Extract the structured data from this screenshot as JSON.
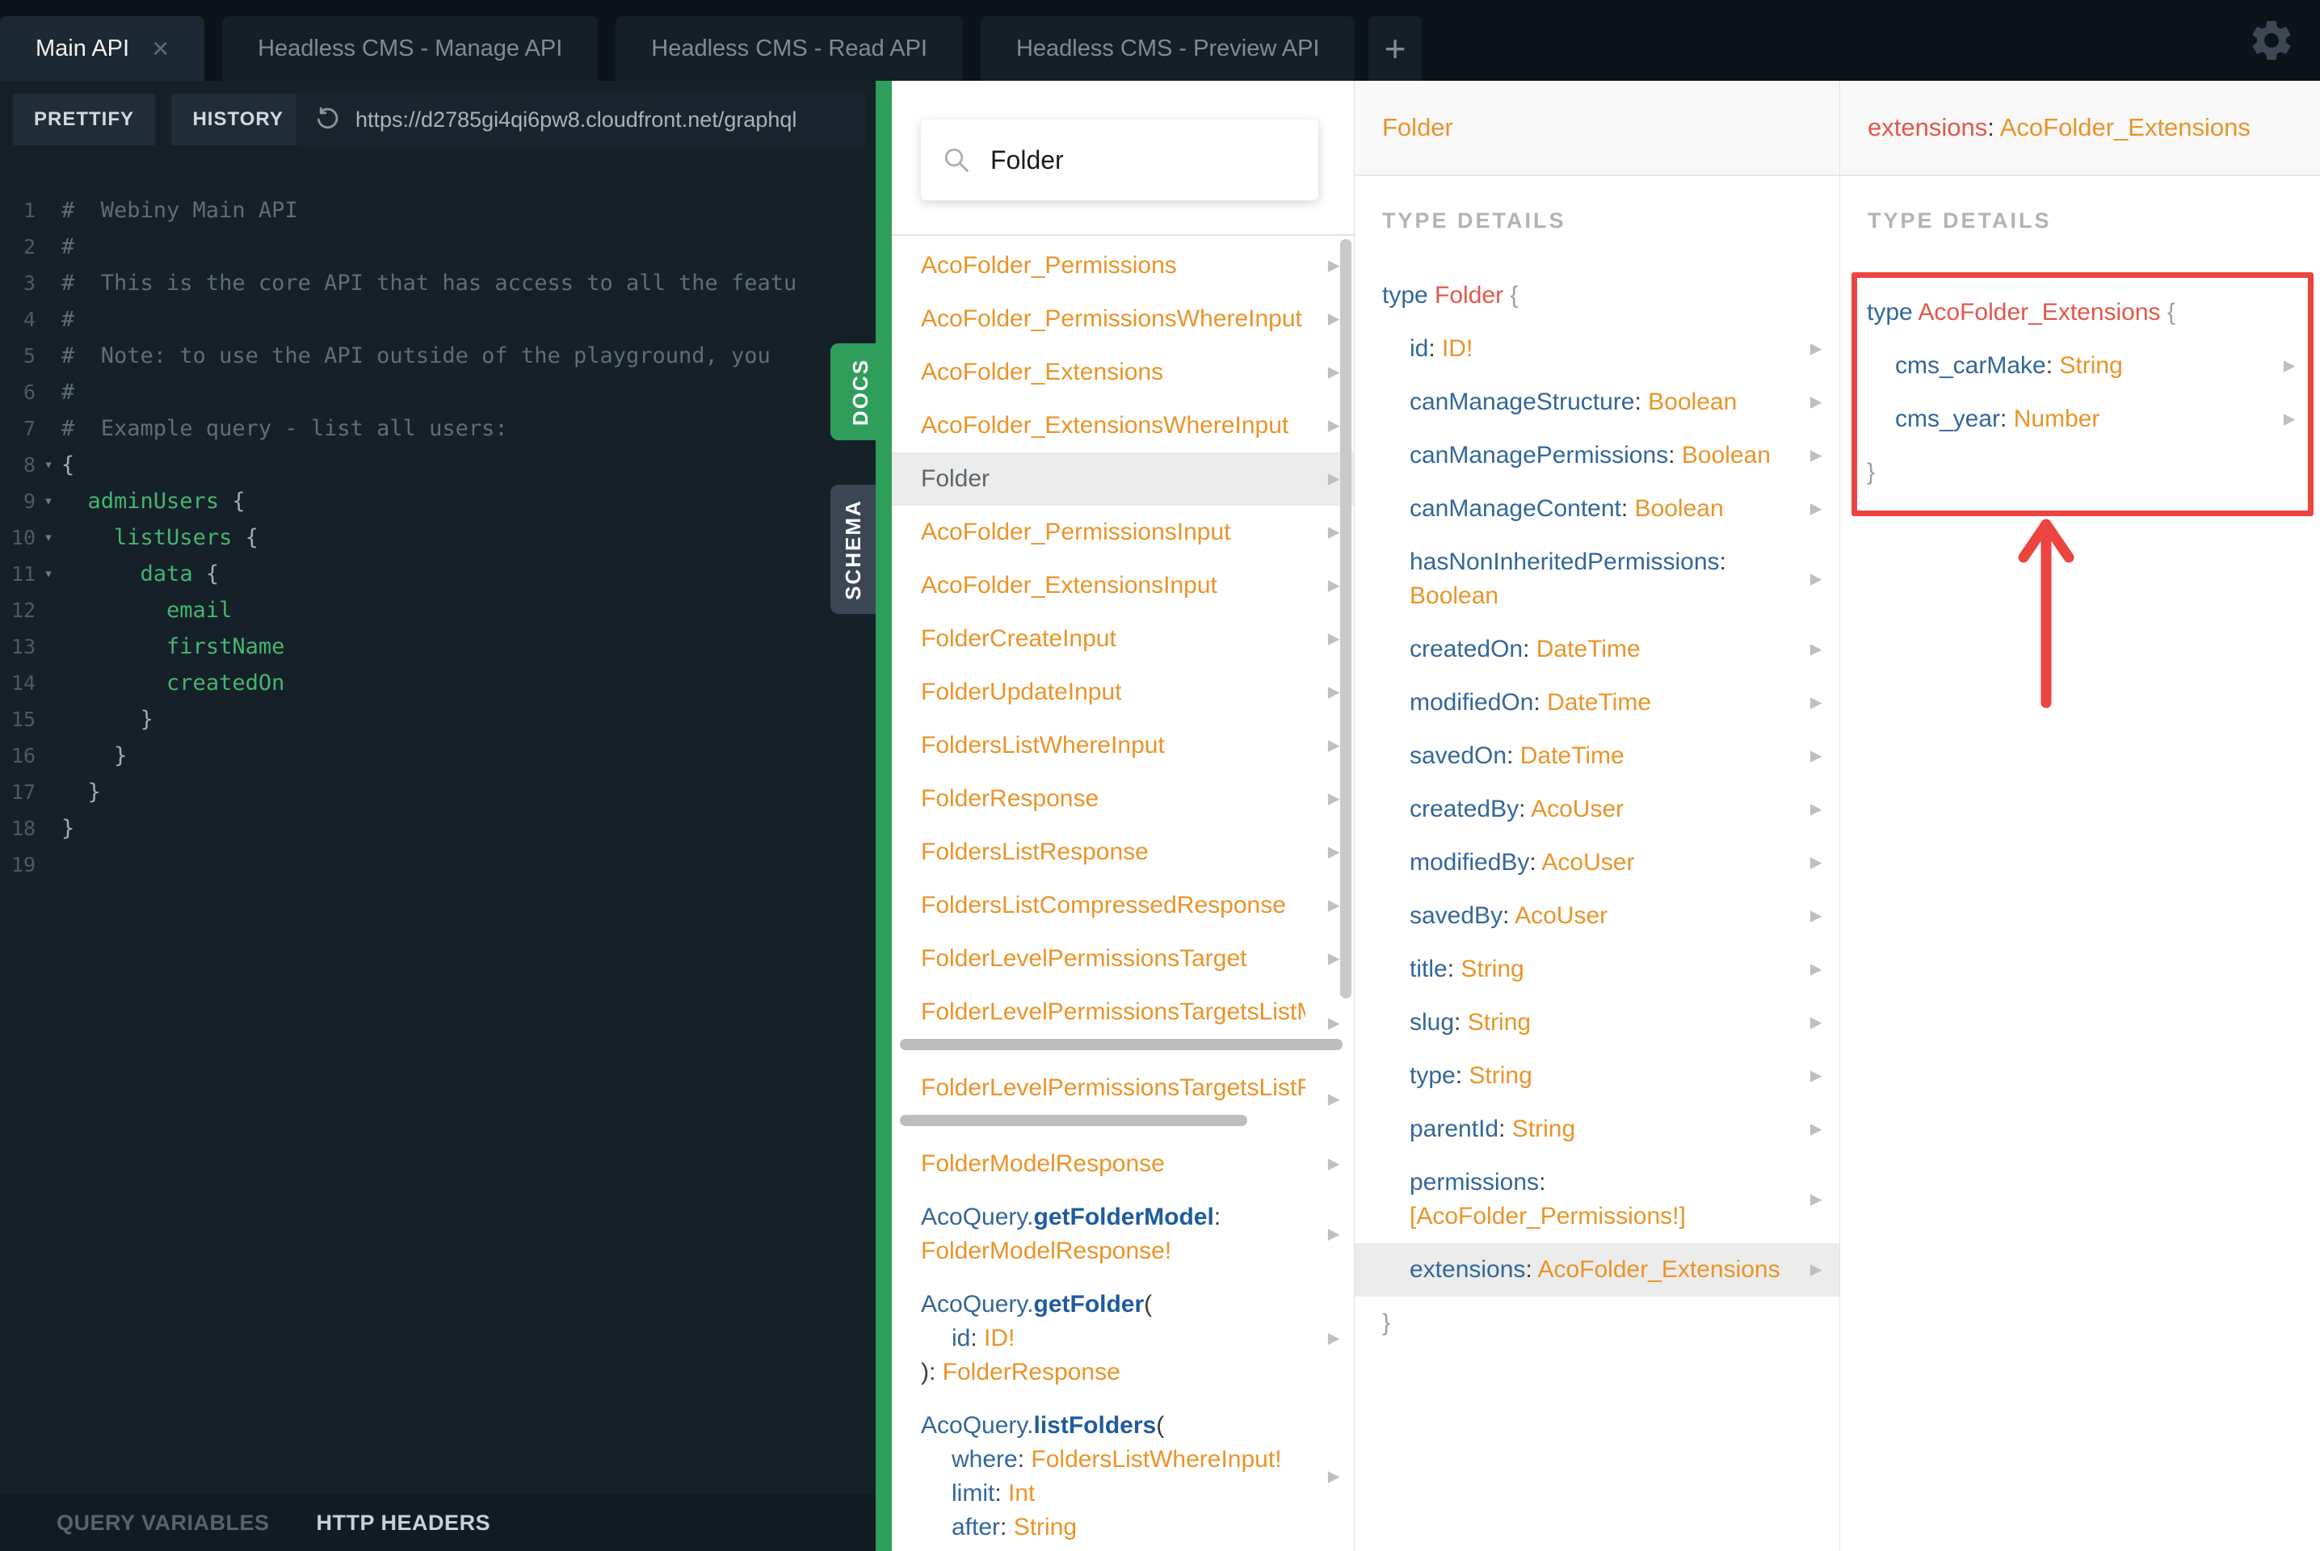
{
  "window": {
    "tabs": [
      {
        "label": "Main API",
        "active": true,
        "closable": true
      },
      {
        "label": "Headless CMS - Manage API",
        "active": false,
        "closable": false
      },
      {
        "label": "Headless CMS - Read API",
        "active": false,
        "closable": false
      },
      {
        "label": "Headless CMS - Preview API",
        "active": false,
        "closable": false
      }
    ],
    "new_tab_label": "+"
  },
  "toolbar": {
    "prettify": "PRETTIFY",
    "history": "HISTORY",
    "url": "https://d2785gi4qi6pw8.cloudfront.net/graphql"
  },
  "editor": {
    "lines": [
      {
        "n": "1",
        "fold": false,
        "s": [
          [
            "c",
            "#  Webiny Main API"
          ]
        ]
      },
      {
        "n": "2",
        "fold": false,
        "s": [
          [
            "c",
            "#"
          ]
        ]
      },
      {
        "n": "3",
        "fold": false,
        "s": [
          [
            "c",
            "#  This is the core API that has access to all the featu"
          ]
        ]
      },
      {
        "n": "4",
        "fold": false,
        "s": [
          [
            "c",
            "#"
          ]
        ]
      },
      {
        "n": "5",
        "fold": false,
        "s": [
          [
            "c",
            "#  Note: to use the API outside of the playground, you"
          ]
        ]
      },
      {
        "n": "6",
        "fold": false,
        "s": [
          [
            "c",
            "#"
          ]
        ]
      },
      {
        "n": "7",
        "fold": false,
        "s": [
          [
            "c",
            "#  Example query - list all users:"
          ]
        ]
      },
      {
        "n": "8",
        "fold": true,
        "s": [
          [
            "p",
            "{"
          ]
        ]
      },
      {
        "n": "9",
        "fold": true,
        "s": [
          [
            "p",
            "  "
          ],
          [
            "g",
            "adminUsers"
          ],
          [
            "p",
            " {"
          ]
        ]
      },
      {
        "n": "10",
        "fold": true,
        "s": [
          [
            "p",
            "    "
          ],
          [
            "g",
            "listUsers"
          ],
          [
            "p",
            " {"
          ]
        ]
      },
      {
        "n": "11",
        "fold": true,
        "s": [
          [
            "p",
            "      "
          ],
          [
            "g",
            "data"
          ],
          [
            "p",
            " {"
          ]
        ]
      },
      {
        "n": "12",
        "fold": false,
        "s": [
          [
            "p",
            "        "
          ],
          [
            "g",
            "email"
          ]
        ]
      },
      {
        "n": "13",
        "fold": false,
        "s": [
          [
            "p",
            "        "
          ],
          [
            "g",
            "firstName"
          ]
        ]
      },
      {
        "n": "14",
        "fold": false,
        "s": [
          [
            "p",
            "        "
          ],
          [
            "g",
            "createdOn"
          ]
        ]
      },
      {
        "n": "15",
        "fold": false,
        "s": [
          [
            "p",
            "      }"
          ]
        ]
      },
      {
        "n": "16",
        "fold": false,
        "s": [
          [
            "p",
            "    }"
          ]
        ]
      },
      {
        "n": "17",
        "fold": false,
        "s": [
          [
            "p",
            "  }"
          ]
        ]
      },
      {
        "n": "18",
        "fold": false,
        "s": [
          [
            "p",
            "}"
          ]
        ]
      },
      {
        "n": "19",
        "fold": false,
        "s": []
      }
    ]
  },
  "side_tabs": {
    "docs": "DOCS",
    "schema": "SCHEMA"
  },
  "footer": {
    "query_variables": "QUERY VARIABLES",
    "http_headers": "HTTP HEADERS"
  },
  "docs_panel": {
    "search_value": "Folder",
    "items": [
      {
        "arrow": true,
        "lines": [
          {
            "s": [
              [
                "t",
                "AcoFolder_Permissions"
              ]
            ]
          }
        ]
      },
      {
        "arrow": true,
        "lines": [
          {
            "s": [
              [
                "t",
                "AcoFolder_PermissionsWhereInput"
              ]
            ]
          }
        ]
      },
      {
        "arrow": true,
        "lines": [
          {
            "s": [
              [
                "t",
                "AcoFolder_Extensions"
              ]
            ]
          }
        ]
      },
      {
        "arrow": true,
        "lines": [
          {
            "s": [
              [
                "t",
                "AcoFolder_ExtensionsWhereInput"
              ]
            ]
          }
        ]
      },
      {
        "arrow": true,
        "highlight": true,
        "lines": [
          {
            "s": [
              [
                "sel",
                "Folder"
              ]
            ]
          }
        ]
      },
      {
        "arrow": true,
        "lines": [
          {
            "s": [
              [
                "t",
                "AcoFolder_PermissionsInput"
              ]
            ]
          }
        ]
      },
      {
        "arrow": true,
        "lines": [
          {
            "s": [
              [
                "t",
                "AcoFolder_ExtensionsInput"
              ]
            ]
          }
        ]
      },
      {
        "arrow": true,
        "lines": [
          {
            "s": [
              [
                "t",
                "FolderCreateInput"
              ]
            ]
          }
        ]
      },
      {
        "arrow": true,
        "lines": [
          {
            "s": [
              [
                "t",
                "FolderUpdateInput"
              ]
            ]
          }
        ]
      },
      {
        "arrow": true,
        "lines": [
          {
            "s": [
              [
                "t",
                "FoldersListWhereInput"
              ]
            ]
          }
        ]
      },
      {
        "arrow": true,
        "lines": [
          {
            "s": [
              [
                "t",
                "FolderResponse"
              ]
            ]
          }
        ]
      },
      {
        "arrow": true,
        "lines": [
          {
            "s": [
              [
                "t",
                "FoldersListResponse"
              ]
            ]
          }
        ]
      },
      {
        "arrow": true,
        "lines": [
          {
            "s": [
              [
                "t",
                "FoldersListCompressedResponse"
              ]
            ]
          }
        ]
      },
      {
        "arrow": true,
        "lines": [
          {
            "s": [
              [
                "t",
                "FolderLevelPermissionsTarget"
              ]
            ]
          }
        ]
      },
      {
        "arrow": true,
        "hbar": 548,
        "lines": [
          {
            "s": [
              [
                "t",
                "FolderLevelPermissionsTargetsListMeta"
              ]
            ]
          }
        ]
      },
      {
        "arrow": true,
        "hbar": 430,
        "lines": [
          {
            "s": [
              [
                "t",
                "FolderLevelPermissionsTargetsListRespo"
              ]
            ]
          }
        ]
      },
      {
        "arrow": true,
        "lines": [
          {
            "s": [
              [
                "t",
                "FolderModelResponse"
              ]
            ]
          }
        ]
      },
      {
        "arrow": true,
        "lines": [
          {
            "s": [
              [
                "q",
                "AcoQuery."
              ],
              [
                "qb",
                "getFolderModel"
              ],
              [
                "pu",
                ":"
              ]
            ]
          },
          {
            "s": [
              [
                "t",
                "FolderModelResponse!"
              ]
            ]
          }
        ]
      },
      {
        "arrow": true,
        "lines": [
          {
            "s": [
              [
                "q",
                "AcoQuery."
              ],
              [
                "qb",
                "getFolder"
              ],
              [
                "pu",
                "("
              ]
            ]
          },
          {
            "ind": 1,
            "s": [
              [
                "q",
                "id"
              ],
              [
                "pu",
                ": "
              ],
              [
                "t",
                "ID!"
              ]
            ]
          },
          {
            "s": [
              [
                "pu",
                "): "
              ],
              [
                "t",
                "FolderResponse"
              ]
            ]
          }
        ]
      },
      {
        "arrow": true,
        "lines": [
          {
            "s": [
              [
                "q",
                "AcoQuery."
              ],
              [
                "qb",
                "listFolders"
              ],
              [
                "pu",
                "("
              ]
            ]
          },
          {
            "ind": 1,
            "s": [
              [
                "q",
                "where"
              ],
              [
                "pu",
                ": "
              ],
              [
                "t",
                "FoldersListWhereInput!"
              ]
            ]
          },
          {
            "ind": 1,
            "s": [
              [
                "q",
                "limit"
              ],
              [
                "pu",
                ": "
              ],
              [
                "t",
                "Int"
              ]
            ]
          },
          {
            "ind": 1,
            "s": [
              [
                "q",
                "after"
              ],
              [
                "pu",
                ": "
              ],
              [
                "t",
                "String"
              ]
            ]
          }
        ]
      }
    ]
  },
  "type_panel": {
    "header": "Folder",
    "section_label": "TYPE DETAILS",
    "rows": [
      {
        "s": [
          [
            "kw",
            "type "
          ],
          [
            "name",
            "Folder "
          ],
          [
            "brace",
            "{"
          ]
        ]
      },
      {
        "ind": 1,
        "arrow": true,
        "s": [
          [
            "fld",
            "id"
          ],
          [
            "pu",
            ": "
          ],
          [
            "t",
            "ID!"
          ]
        ]
      },
      {
        "ind": 1,
        "arrow": true,
        "s": [
          [
            "fld",
            "canManageStructure"
          ],
          [
            "pu",
            ": "
          ],
          [
            "t",
            "Boolean"
          ]
        ]
      },
      {
        "ind": 1,
        "arrow": true,
        "s": [
          [
            "fld",
            "canManagePermissions"
          ],
          [
            "pu",
            ": "
          ],
          [
            "t",
            "Boolean"
          ]
        ]
      },
      {
        "ind": 1,
        "arrow": true,
        "s": [
          [
            "fld",
            "canManageContent"
          ],
          [
            "pu",
            ": "
          ],
          [
            "t",
            "Boolean"
          ]
        ]
      },
      {
        "ind": 1,
        "arrow": true,
        "s": [
          [
            "fld",
            "hasNonInheritedPermissions"
          ],
          [
            "pu",
            ": "
          ],
          [
            "t",
            "Boolean"
          ]
        ]
      },
      {
        "ind": 1,
        "arrow": true,
        "s": [
          [
            "fld",
            "createdOn"
          ],
          [
            "pu",
            ": "
          ],
          [
            "t",
            "DateTime"
          ]
        ]
      },
      {
        "ind": 1,
        "arrow": true,
        "s": [
          [
            "fld",
            "modifiedOn"
          ],
          [
            "pu",
            ": "
          ],
          [
            "t",
            "DateTime"
          ]
        ]
      },
      {
        "ind": 1,
        "arrow": true,
        "s": [
          [
            "fld",
            "savedOn"
          ],
          [
            "pu",
            ": "
          ],
          [
            "t",
            "DateTime"
          ]
        ]
      },
      {
        "ind": 1,
        "arrow": true,
        "s": [
          [
            "fld",
            "createdBy"
          ],
          [
            "pu",
            ": "
          ],
          [
            "t",
            "AcoUser"
          ]
        ]
      },
      {
        "ind": 1,
        "arrow": true,
        "s": [
          [
            "fld",
            "modifiedBy"
          ],
          [
            "pu",
            ": "
          ],
          [
            "t",
            "AcoUser"
          ]
        ]
      },
      {
        "ind": 1,
        "arrow": true,
        "s": [
          [
            "fld",
            "savedBy"
          ],
          [
            "pu",
            ": "
          ],
          [
            "t",
            "AcoUser"
          ]
        ]
      },
      {
        "ind": 1,
        "arrow": true,
        "s": [
          [
            "fld",
            "title"
          ],
          [
            "pu",
            ": "
          ],
          [
            "t",
            "String"
          ]
        ]
      },
      {
        "ind": 1,
        "arrow": true,
        "s": [
          [
            "fld",
            "slug"
          ],
          [
            "pu",
            ": "
          ],
          [
            "t",
            "String"
          ]
        ]
      },
      {
        "ind": 1,
        "arrow": true,
        "s": [
          [
            "fld",
            "type"
          ],
          [
            "pu",
            ": "
          ],
          [
            "t",
            "String"
          ]
        ]
      },
      {
        "ind": 1,
        "arrow": true,
        "s": [
          [
            "fld",
            "parentId"
          ],
          [
            "pu",
            ": "
          ],
          [
            "t",
            "String"
          ]
        ]
      },
      {
        "ind": 1,
        "arrow": true,
        "s": [
          [
            "fld",
            "permissions"
          ],
          [
            "pu",
            ": "
          ],
          [
            "t",
            "[AcoFolder_Permissions!]"
          ]
        ]
      },
      {
        "ind": 1,
        "arrow": true,
        "highlight": true,
        "s": [
          [
            "fld",
            "extensions"
          ],
          [
            "pu",
            ": "
          ],
          [
            "t",
            "AcoFolder_Extensions"
          ]
        ]
      },
      {
        "s": [
          [
            "brace",
            "}"
          ]
        ]
      }
    ]
  },
  "extensions_panel": {
    "header": [
      [
        "name",
        "extensions"
      ],
      [
        "pu",
        ": "
      ],
      [
        "t",
        "AcoFolder_Extensions"
      ]
    ],
    "section_label": "TYPE DETAILS",
    "rows": [
      {
        "s": [
          [
            "kw",
            "type "
          ],
          [
            "name",
            "AcoFolder_Extensions "
          ],
          [
            "brace",
            "{"
          ]
        ]
      },
      {
        "ind": 1,
        "arrow": true,
        "s": [
          [
            "fld",
            "cms_carMake"
          ],
          [
            "pu",
            ": "
          ],
          [
            "t",
            "String"
          ]
        ]
      },
      {
        "ind": 1,
        "arrow": true,
        "s": [
          [
            "fld",
            "cms_year"
          ],
          [
            "pu",
            ": "
          ],
          [
            "t",
            "Number"
          ]
        ]
      },
      {
        "s": [
          [
            "brace",
            "}"
          ]
        ]
      }
    ]
  },
  "colors": {
    "accent_green": "#2f9e5b",
    "type_orange": "#ea9429",
    "field_blue": "#32679b",
    "type_name_red": "#e2574d",
    "annotation_red": "#ec4540",
    "highlight_gray": "#ececec",
    "editor_bg": "#152028"
  }
}
